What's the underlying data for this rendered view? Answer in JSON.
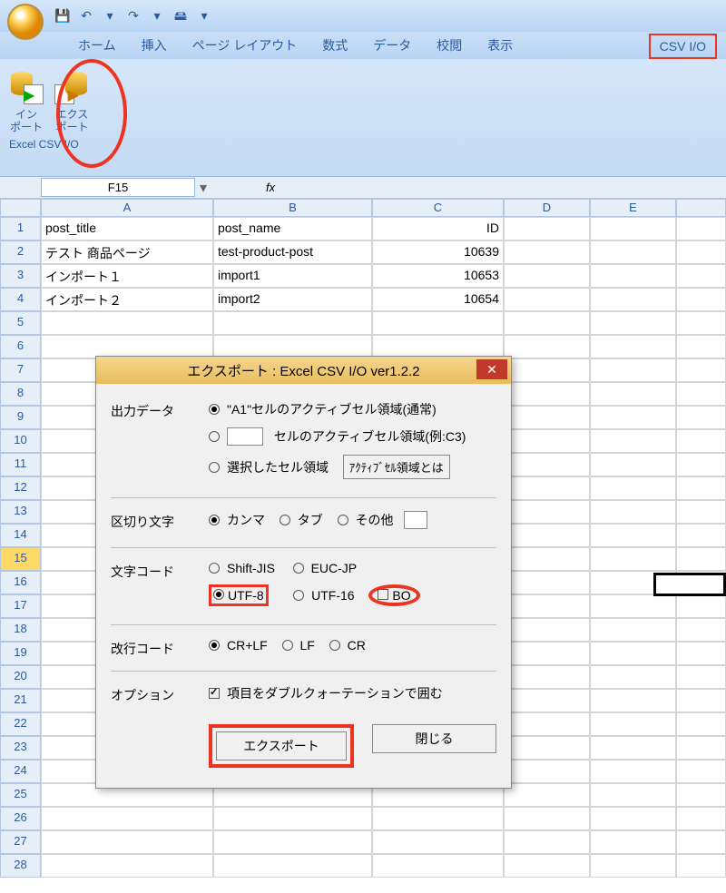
{
  "tabs": {
    "home": "ホーム",
    "insert": "挿入",
    "layout": "ページ レイアウト",
    "formula": "数式",
    "data": "データ",
    "review": "校閲",
    "view": "表示",
    "csv": "CSV I/O"
  },
  "ribbon": {
    "import": "イン\nポート",
    "export": "エクス\nポート",
    "group": "Excel CSV I/O"
  },
  "namebox": "F15",
  "fx": "fx",
  "cols": [
    "A",
    "B",
    "C",
    "D",
    "E"
  ],
  "rows": [
    {
      "n": "1",
      "A": "post_title",
      "B": "post_name",
      "C": "ID",
      "D": "",
      "E": ""
    },
    {
      "n": "2",
      "A": "テスト 商品ページ",
      "B": "test-product-post",
      "C": "10639",
      "D": "",
      "E": ""
    },
    {
      "n": "3",
      "A": "インポート１",
      "B": "import1",
      "C": "10653",
      "D": "",
      "E": ""
    },
    {
      "n": "4",
      "A": "インポート２",
      "B": "import2",
      "C": "10654",
      "D": "",
      "E": ""
    }
  ],
  "blank_rows": [
    "5",
    "6",
    "7",
    "8",
    "9",
    "10",
    "11",
    "12",
    "13",
    "14",
    "15",
    "16",
    "17",
    "18",
    "19",
    "20",
    "21",
    "22",
    "23",
    "24",
    "25",
    "26",
    "27",
    "28"
  ],
  "dialog": {
    "title": "エクスポート : Excel CSV I/O ver1.2.2",
    "sec_output": "出力データ",
    "opt_a1": "\"A1\"セルのアクティブセル領域(通常)",
    "opt_cell": "セルのアクティブセル領域(例:C3)",
    "opt_sel": "選択したセル領域",
    "btn_what": "ｱｸﾃｨﾌﾞｾﾙ領域とは",
    "sec_delim": "区切り文字",
    "delim_comma": "カンマ",
    "delim_tab": "タブ",
    "delim_other": "その他",
    "sec_enc": "文字コード",
    "enc_sjis": "Shift-JIS",
    "enc_euc": "EUC-JP",
    "enc_utf8": "UTF-8",
    "enc_utf16": "UTF-16",
    "enc_bom": "BO",
    "sec_crlf": "改行コード",
    "crlf": "CR+LF",
    "lf": "LF",
    "cr": "CR",
    "sec_opt": "オプション",
    "opt_quote": "項目をダブルクォーテーションで囲む",
    "btn_export": "エクスポート",
    "btn_close": "閉じる"
  }
}
